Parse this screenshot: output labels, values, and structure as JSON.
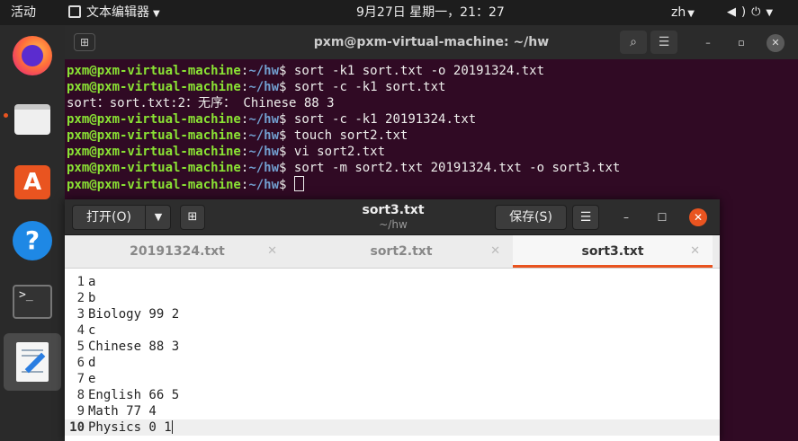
{
  "topbar": {
    "activities": "活动",
    "app_name": "文本编辑器",
    "clock": "9月27日 星期一，21：27",
    "language": "zh"
  },
  "dock": {
    "items": [
      "firefox-icon",
      "files-icon",
      "software-center-icon",
      "help-icon",
      "terminal-icon",
      "text-editor-icon"
    ]
  },
  "terminal": {
    "title": "pxm@pxm-virtual-machine: ~/hw",
    "prompt_user": "pxm@pxm-virtual-machine",
    "prompt_path": "~/hw",
    "lines": [
      {
        "type": "cmd",
        "text": "sort -k1 sort.txt -o 20191324.txt"
      },
      {
        "type": "cmd",
        "text": "sort -c -k1 sort.txt"
      },
      {
        "type": "out",
        "text": "sort：sort.txt:2：无序： Chinese 88 3"
      },
      {
        "type": "cmd",
        "text": "sort -c -k1 20191324.txt"
      },
      {
        "type": "cmd",
        "text": "touch sort2.txt"
      },
      {
        "type": "cmd",
        "text": "vi sort2.txt"
      },
      {
        "type": "cmd",
        "text": "sort -m sort2.txt 20191324.txt -o sort3.txt"
      },
      {
        "type": "cursor",
        "text": ""
      }
    ]
  },
  "gedit": {
    "open_label": "打开(O)",
    "save_label": "保存(S)",
    "title": "sort3.txt",
    "subtitle": "~/hw",
    "tabs": [
      {
        "label": "20191324.txt",
        "active": false
      },
      {
        "label": "sort2.txt",
        "active": false
      },
      {
        "label": "sort3.txt",
        "active": true
      }
    ],
    "lines": [
      {
        "num": "1",
        "text": "a"
      },
      {
        "num": "2",
        "text": "b"
      },
      {
        "num": "3",
        "text": "Biology 99 2"
      },
      {
        "num": "4",
        "text": "c"
      },
      {
        "num": "5",
        "text": "Chinese 88 3"
      },
      {
        "num": "6",
        "text": "d"
      },
      {
        "num": "7",
        "text": "e"
      },
      {
        "num": "8",
        "text": "English 66 5"
      },
      {
        "num": "9",
        "text": "Math 77 4"
      },
      {
        "num": "10",
        "text": "Physics 0 1"
      }
    ],
    "current_line": 10
  },
  "colors": {
    "accent": "#e95420",
    "terminal_bg": "#300a24",
    "prompt_user": "#8ae234",
    "prompt_path": "#729fcf"
  }
}
